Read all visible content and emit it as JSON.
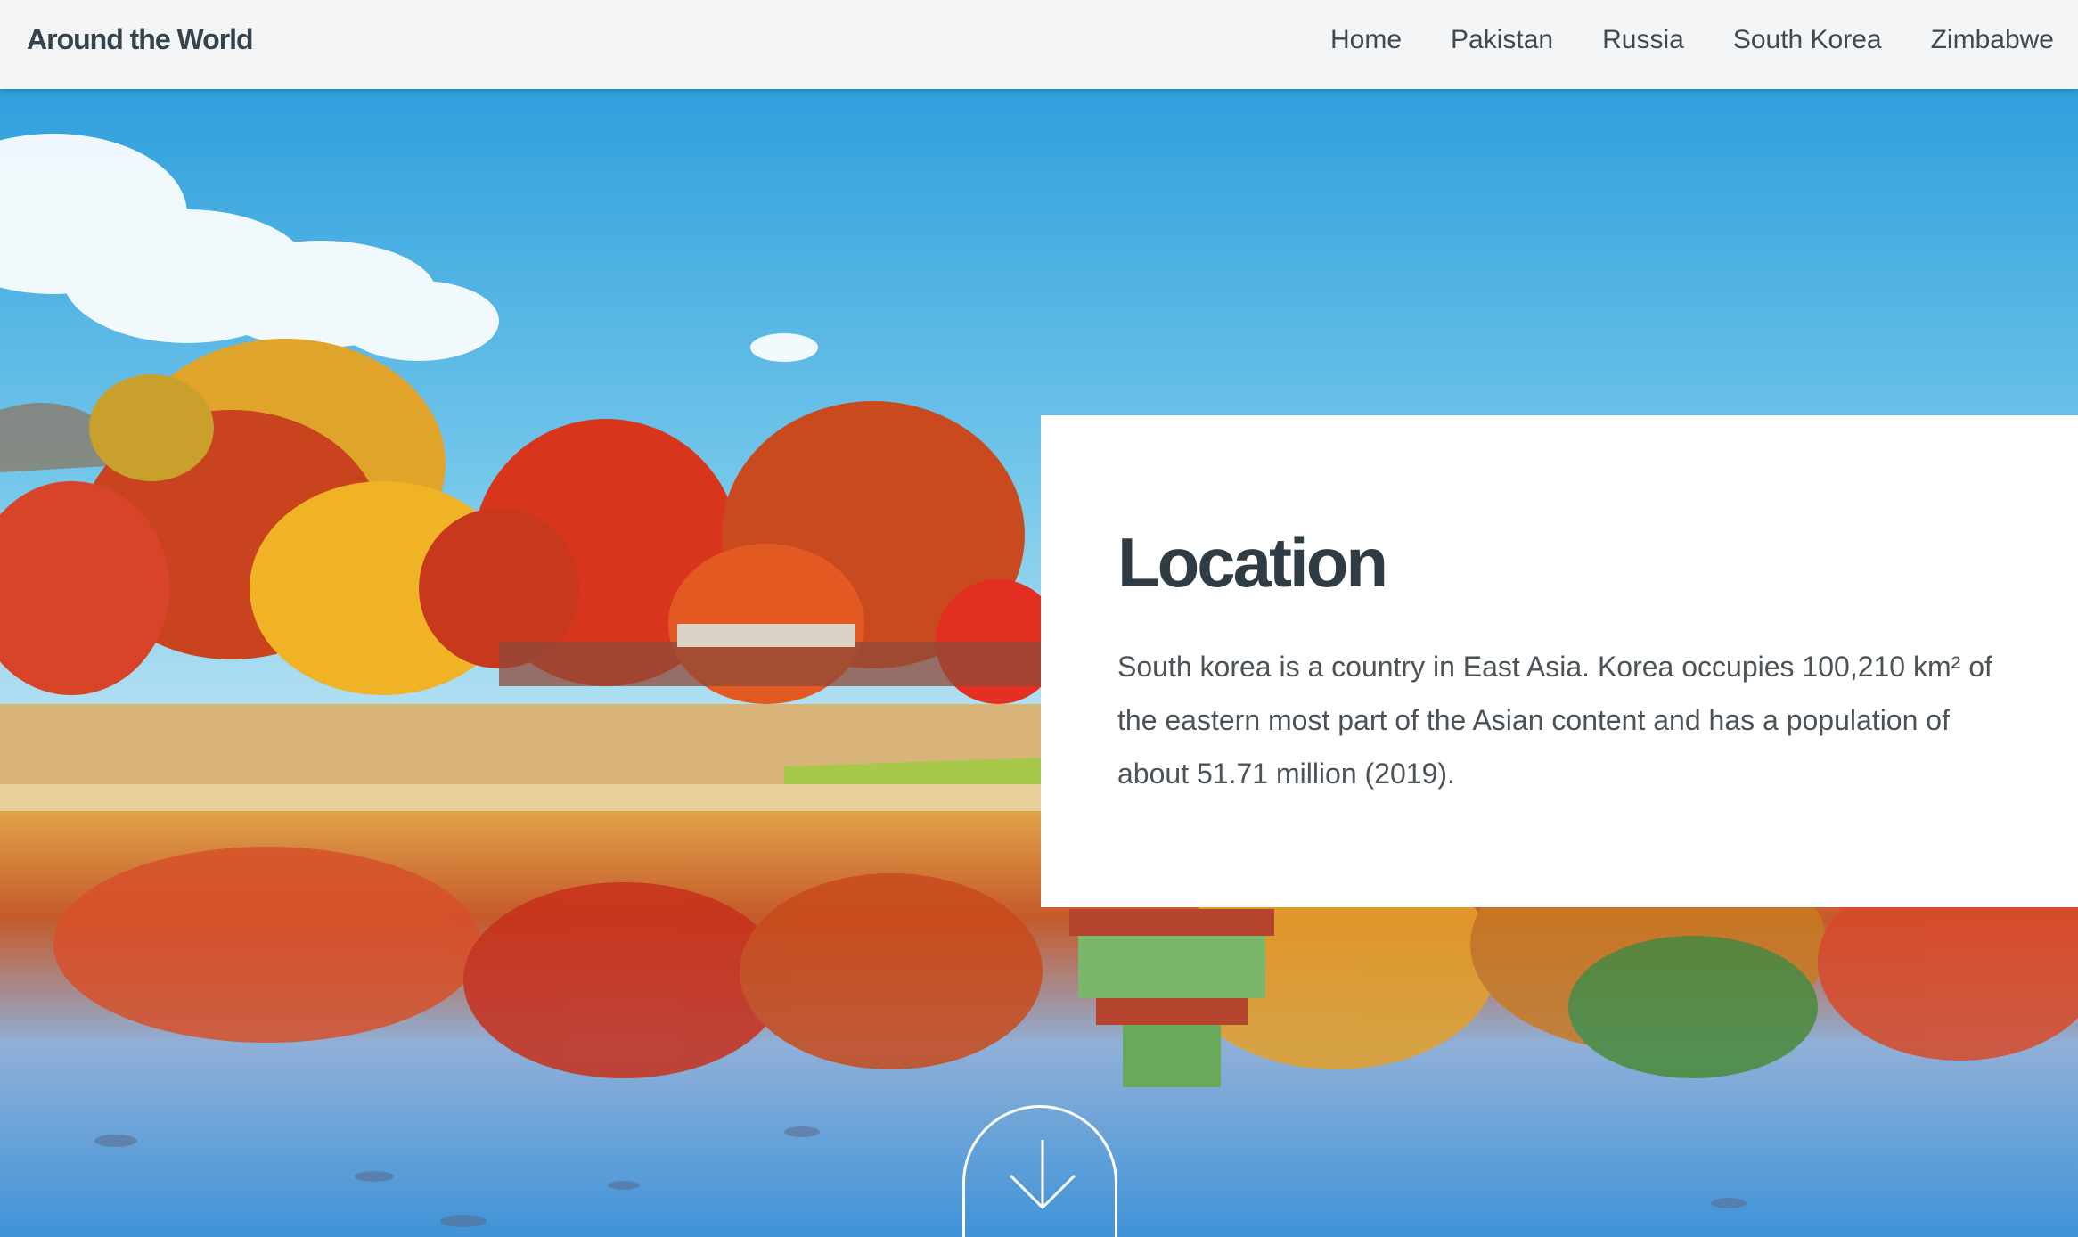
{
  "header": {
    "brand": "Around the World",
    "nav": [
      "Home",
      "Pakistan",
      "Russia",
      "South Korea",
      "Zimbabwe"
    ]
  },
  "hero": {
    "image": "korean-palace-autumn-pond"
  },
  "card": {
    "title": "Location",
    "body": "South korea is a country in East Asia. Korea occupies 100,210 km² of the eastern most part of the Asian content and has a population of about 51.71 million (2019)."
  },
  "scroll_button": {
    "icon": "arrow-down-icon"
  },
  "colors": {
    "navbar_bg": "#f4f5f6",
    "brand_text": "#35444c",
    "card_bg": "#ffffff",
    "title_text": "#303c44",
    "body_text": "#4a5358"
  }
}
